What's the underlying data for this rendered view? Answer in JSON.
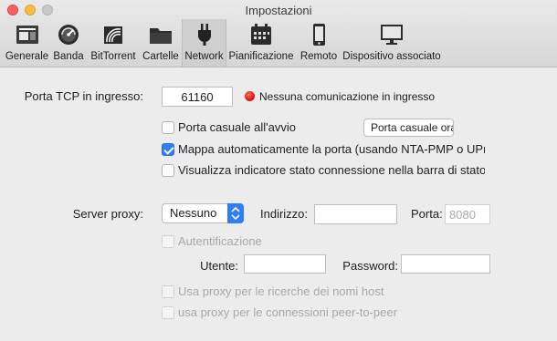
{
  "window": {
    "title": "Impostazioni"
  },
  "toolbar": {
    "items": [
      {
        "label": "Generale",
        "icon": "general-icon"
      },
      {
        "label": "Banda",
        "icon": "speedometer-icon"
      },
      {
        "label": "BitTorrent",
        "icon": "bittorrent-icon"
      },
      {
        "label": "Cartelle",
        "icon": "folder-icon"
      },
      {
        "label": "Network",
        "icon": "plug-icon",
        "selected": true
      },
      {
        "label": "Pianificazione",
        "icon": "calendar-icon"
      },
      {
        "label": "Remoto",
        "icon": "phone-icon"
      },
      {
        "label": "Dispositivo associato",
        "icon": "monitor-icon"
      }
    ]
  },
  "network": {
    "port_label": "Porta TCP in ingresso:",
    "port_value": "61160",
    "status_text": "Nessuna comunicazione in ingresso",
    "status_color": "#e0160c",
    "random_port": {
      "label": "Porta casuale all'avvio",
      "checked": false
    },
    "random_port_button": "Porta casuale ora",
    "map_port": {
      "label": "Mappa automaticamente la porta (usando NTA-PMP o UPnP)",
      "checked": true
    },
    "status_bar": {
      "label": "Visualizza indicatore stato connessione nella barra di stato",
      "checked": false
    }
  },
  "proxy": {
    "server_label": "Server proxy:",
    "server_value": "Nessuno",
    "address_label": "Indirizzo:",
    "address_value": "",
    "port_label": "Porta:",
    "port_value": "8080",
    "auth": {
      "label": "Autentificazione",
      "checked": false
    },
    "user_label": "Utente:",
    "user_value": "",
    "password_label": "Password:",
    "password_value": "",
    "hostname_lookup": {
      "label": "Usa proxy per le ricerche dei nomi host",
      "checked": false
    },
    "peer_connections": {
      "label": "usa proxy per le connessioni peer-to-peer",
      "checked": false
    }
  },
  "colors": {
    "accent": "#2f7ef7",
    "background": "#ececec"
  }
}
